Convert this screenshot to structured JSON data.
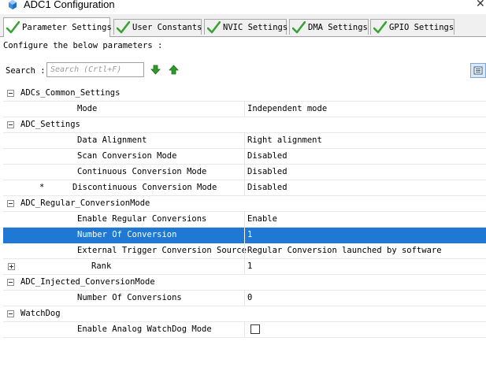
{
  "window": {
    "title": "ADC1 Configuration"
  },
  "tabs": [
    {
      "label": "Parameter Settings",
      "active": true,
      "icon": "green-check-icon"
    },
    {
      "label": "User Constants",
      "active": false,
      "icon": "green-check-icon"
    },
    {
      "label": "NVIC Settings",
      "active": false,
      "icon": "green-check-icon"
    },
    {
      "label": "DMA Settings",
      "active": false,
      "icon": "green-check-icon"
    },
    {
      "label": "GPIO Settings",
      "active": false,
      "icon": "green-check-icon"
    }
  ],
  "content": {
    "instruction": "Configure the below parameters :",
    "search_label": "Search :",
    "search_placeholder": "Search (Crtl+F)"
  },
  "groups": [
    {
      "name": "ADCs_Common_Settings",
      "expanded": true,
      "params": [
        {
          "name": "Mode",
          "value": "Independent mode"
        }
      ]
    },
    {
      "name": "ADC_Settings",
      "expanded": true,
      "params": [
        {
          "name": "Data Alignment",
          "value": "Right alignment"
        },
        {
          "name": "Scan Conversion Mode",
          "value": "Disabled"
        },
        {
          "name": "Continuous Conversion Mode",
          "value": "Disabled"
        },
        {
          "name": "Discontinuous Conversion Mode",
          "value": "Disabled",
          "marker": "*"
        }
      ]
    },
    {
      "name": "ADC_Regular_ConversionMode",
      "expanded": true,
      "params": [
        {
          "name": "Enable Regular Conversions",
          "value": "Enable"
        },
        {
          "name": "Number Of Conversion",
          "value": "1",
          "selected": true
        },
        {
          "name": "External Trigger Conversion Source",
          "value": "Regular Conversion launched by software"
        }
      ],
      "subgroups": [
        {
          "name": "Rank",
          "value": "1",
          "expanded": false
        }
      ]
    },
    {
      "name": "ADC_Injected_ConversionMode",
      "expanded": true,
      "params": [
        {
          "name": "Number Of Conversions",
          "value": "0"
        }
      ]
    },
    {
      "name": "WatchDog",
      "expanded": true,
      "params": [
        {
          "name": "Enable Analog WatchDog Mode",
          "checked": false
        }
      ]
    }
  ]
}
